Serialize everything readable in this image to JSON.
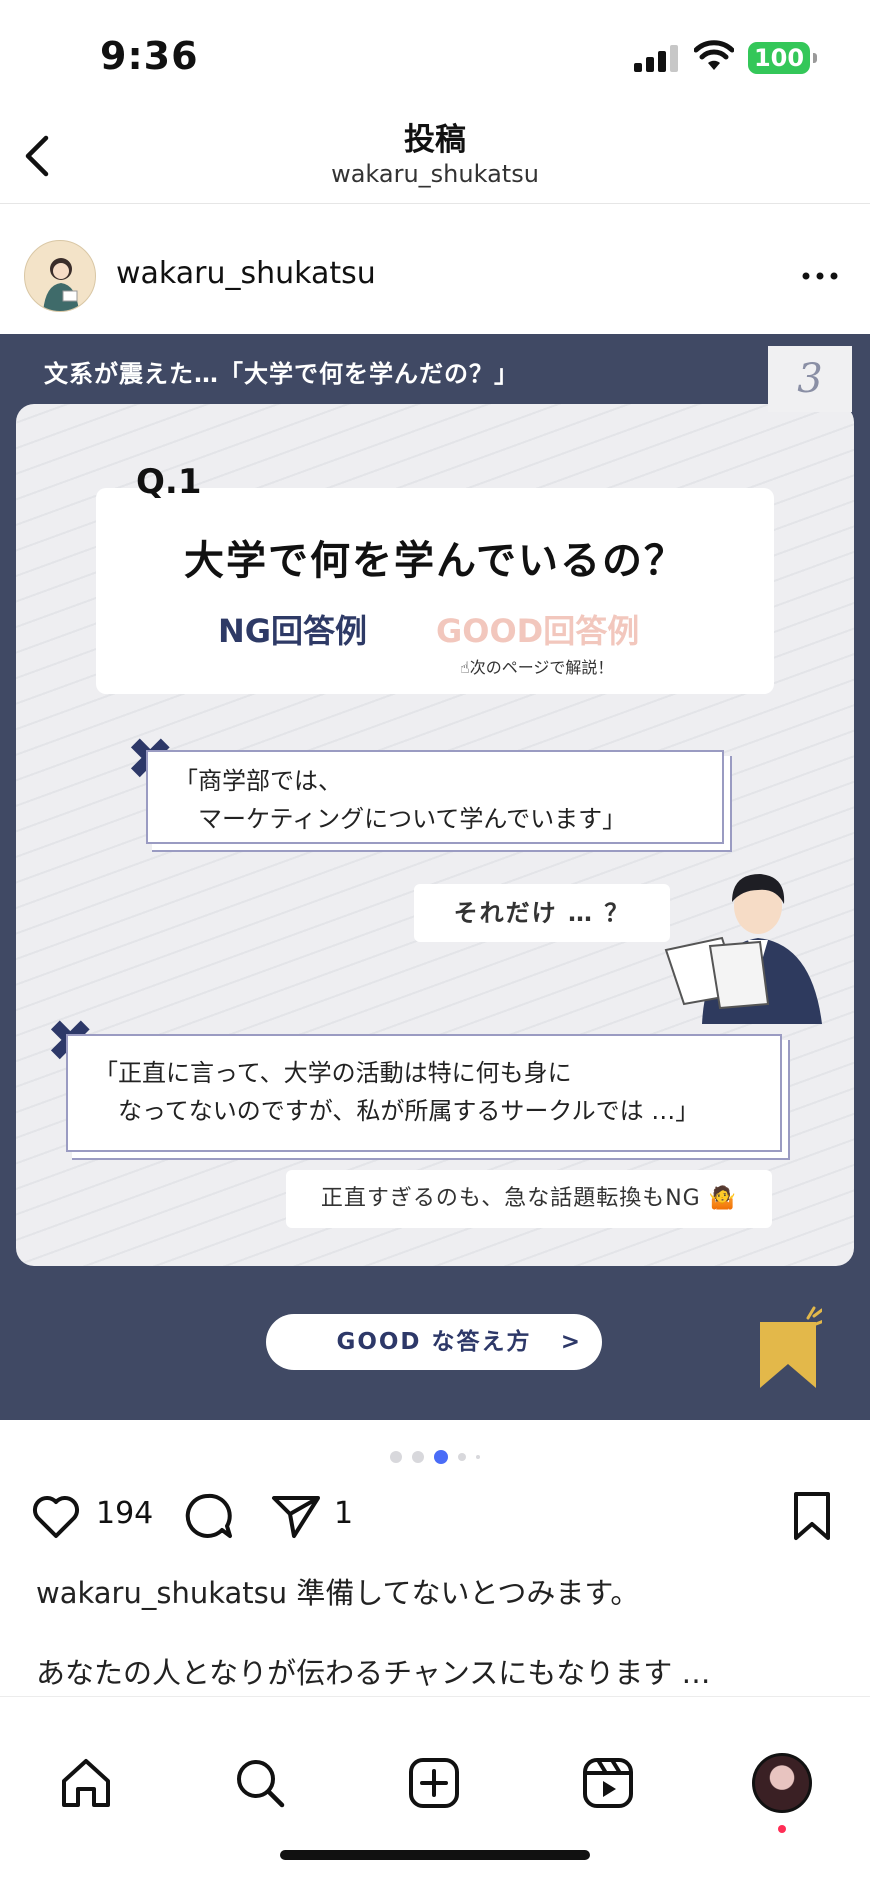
{
  "status_bar": {
    "time": "9:36",
    "battery": "100"
  },
  "header": {
    "title": "投稿",
    "subtitle": "wakaru_shukatsu"
  },
  "post": {
    "username": "wakaru_shukatsu"
  },
  "slide": {
    "header": "文系が震えた…「大学で何を学んだの？」",
    "page": "3",
    "question_label": "Q.1",
    "question": "大学で何を学んでいるの？",
    "ng_label": "NG回答例",
    "good_label": "GOOD回答例",
    "hint": "☝次のページで解説！",
    "bubble1_line1": "「商学部では、",
    "bubble1_line2": "　マーケティングについて学んでいます」",
    "reply1": "それだけ … ？",
    "bubble2_line1": "「正直に言って、大学の活動は特に何も身に",
    "bubble2_line2": "　なってないのですが、私が所属するサークルでは …」",
    "reply2": "正直すぎるのも、急な話題転換もNG 🤷",
    "button": "GOOD な答え方",
    "button_chevron": ">"
  },
  "actions": {
    "likes": "194",
    "shares": "1"
  },
  "caption": {
    "username": "wakaru_shukatsu",
    "text": " 準備してないとつみます。",
    "line2": "あなたの人となりが伝わるチャンスにもなります …"
  },
  "colors": {
    "slide_bg": "#404964",
    "accent": "#2d3868",
    "active_dot": "#4a6cf7",
    "battery": "#34c759"
  }
}
